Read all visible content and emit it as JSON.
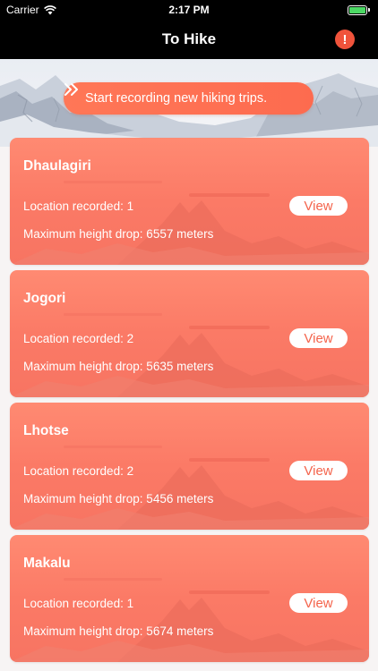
{
  "status_bar": {
    "carrier": "Carrier",
    "time": "2:17 PM"
  },
  "nav": {
    "title": "To Hike",
    "alert_glyph": "!"
  },
  "banner": {
    "record_label": "Start recording new hiking trips."
  },
  "colors": {
    "accent": "#fd6b4f",
    "card": "#fb7a66",
    "alert": "#f0533b"
  },
  "trips": [
    {
      "name": "Dhaulagiri",
      "location": "Location recorded: 1",
      "height": "Maximum height drop: 6557 meters",
      "view": "View"
    },
    {
      "name": "Jogori",
      "location": "Location recorded: 2",
      "height": "Maximum height drop: 5635 meters",
      "view": "View"
    },
    {
      "name": "Lhotse",
      "location": "Location recorded: 2",
      "height": "Maximum height drop: 5456 meters",
      "view": "View"
    },
    {
      "name": "Makalu",
      "location": "Location recorded: 1",
      "height": "Maximum height drop: 5674 meters",
      "view": "View"
    }
  ]
}
